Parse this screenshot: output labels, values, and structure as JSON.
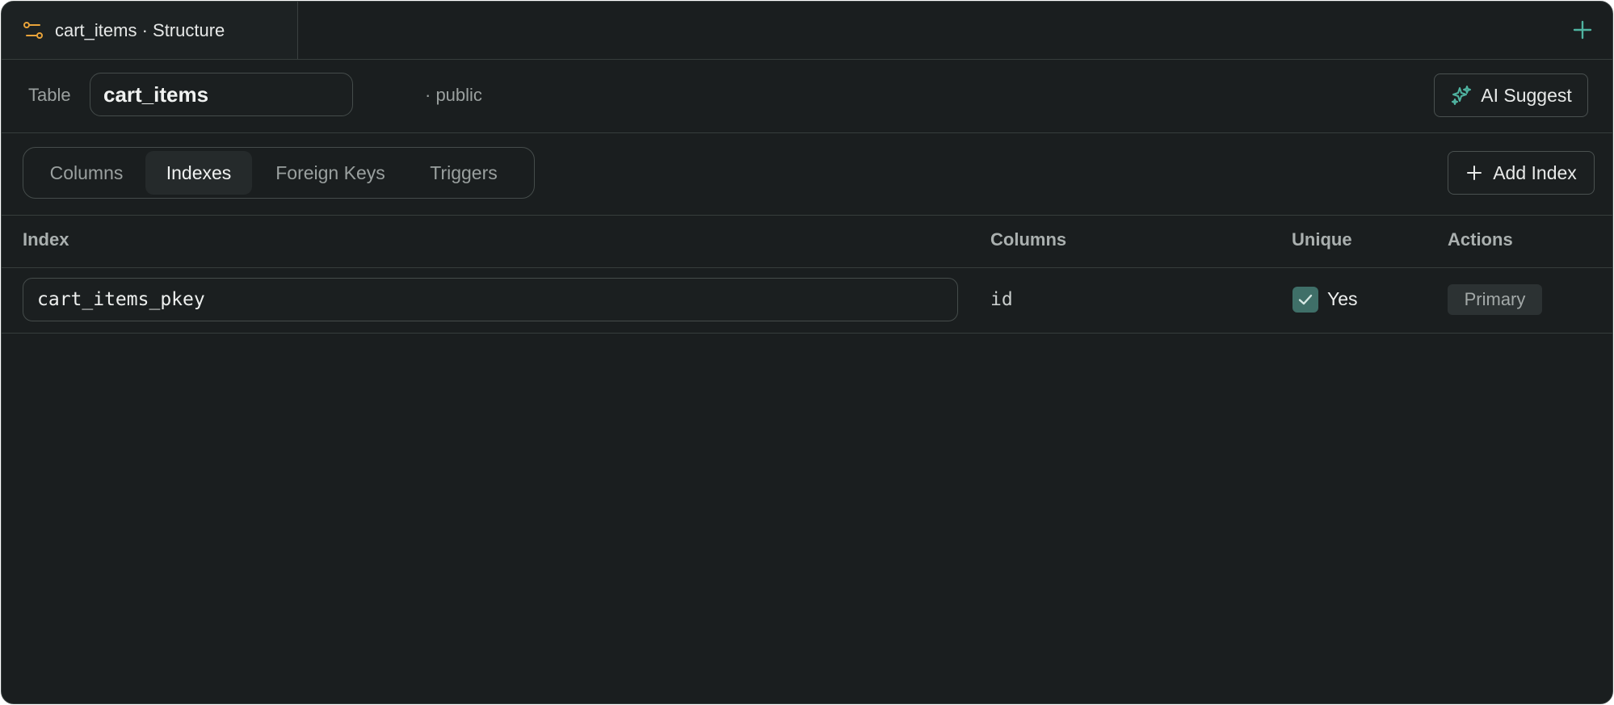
{
  "tab": {
    "title": "cart_items · Structure",
    "icon": "table-structure-icon",
    "new_tab_icon": "plus-icon"
  },
  "table": {
    "label": "Table",
    "name": "cart_items",
    "schema": "· public"
  },
  "ai_button": {
    "label": "AI Suggest",
    "icon": "sparkles-icon"
  },
  "tabs": [
    {
      "label": "Columns",
      "active": false
    },
    {
      "label": "Indexes",
      "active": true
    },
    {
      "label": "Foreign Keys",
      "active": false
    },
    {
      "label": "Triggers",
      "active": false
    }
  ],
  "add_button": {
    "label": "Add Index",
    "icon": "plus-icon"
  },
  "index_table": {
    "headers": [
      "Index",
      "Columns",
      "Unique",
      "Actions"
    ],
    "rows": [
      {
        "index": "cart_items_pkey",
        "columns": "id",
        "unique": true,
        "unique_label": "Yes",
        "action": "Primary"
      }
    ]
  },
  "colors": {
    "accent_teal": "#4fb3a0",
    "accent_orange": "#e8a33a",
    "background": "#1a1e1f",
    "checkbox": "#3f6f68"
  }
}
